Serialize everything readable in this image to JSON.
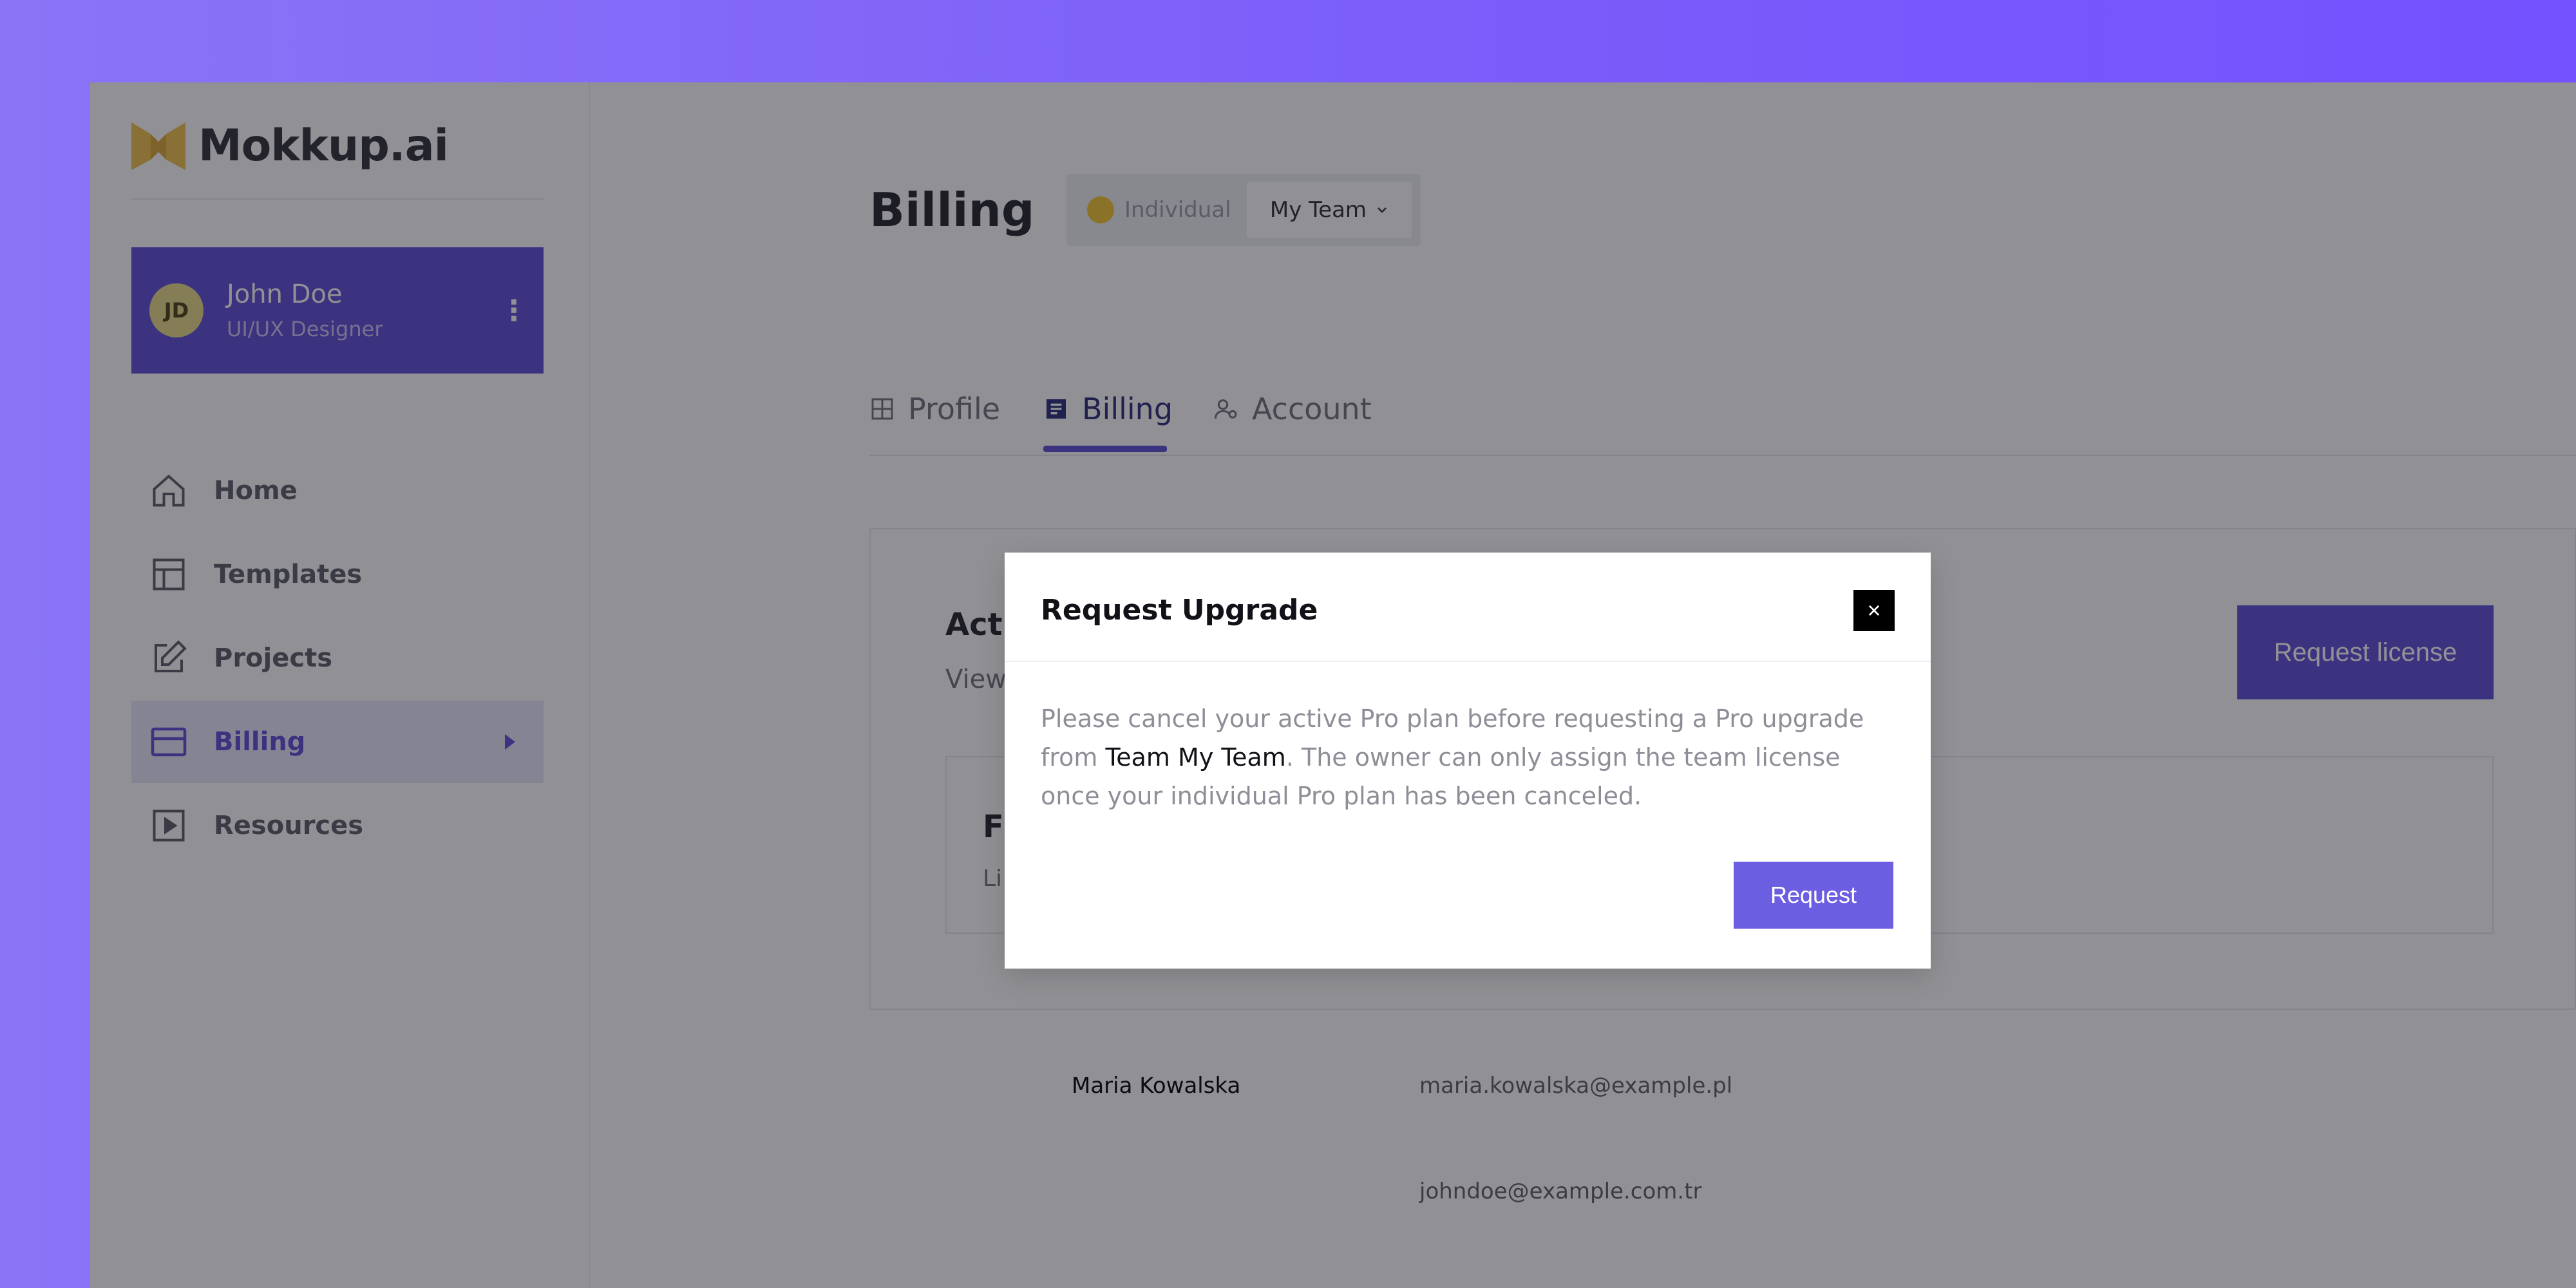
{
  "brand": {
    "name": "Mokkup.ai",
    "logo_color": "#f0c04a"
  },
  "user": {
    "initials": "JD",
    "name": "John Doe",
    "role": "UI/UX Designer"
  },
  "sidebar": {
    "items": [
      {
        "label": "Home",
        "icon": "home-icon"
      },
      {
        "label": "Templates",
        "icon": "layout-icon"
      },
      {
        "label": "Projects",
        "icon": "edit-icon"
      },
      {
        "label": "Billing",
        "icon": "credit-card-icon",
        "active": true
      },
      {
        "label": "Resources",
        "icon": "play-square-icon"
      }
    ]
  },
  "header": {
    "title": "Billing",
    "switcher": {
      "individual": "Individual",
      "team": "My Team"
    }
  },
  "tabs": [
    {
      "label": "Profile",
      "icon": "layout-icon"
    },
    {
      "label": "Billing",
      "icon": "document-icon",
      "active": true
    },
    {
      "label": "Account",
      "icon": "users-icon"
    }
  ],
  "panel": {
    "title": "Active Plan Overview",
    "subtitle": "View",
    "request_license": "Request license",
    "inner_title": "F",
    "inner_sub": "Li"
  },
  "members": [
    {
      "name": "Maria Kowalska",
      "email": "maria.kowalska@example.pl"
    },
    {
      "name": "",
      "email": "johndoe@example.com.tr"
    }
  ],
  "modal": {
    "title": "Request Upgrade",
    "close": "×",
    "body_before": "Please cancel your active Pro plan before requesting a Pro upgrade from ",
    "body_strong": "Team My Team",
    "body_after": ". The owner can only assign the team license once your individual Pro plan has been canceled.",
    "request": "Request"
  },
  "colors": {
    "accent": "#5b4bd6",
    "background_gradient_start": "#8b74f6",
    "background_gradient_end": "#7352ff"
  }
}
